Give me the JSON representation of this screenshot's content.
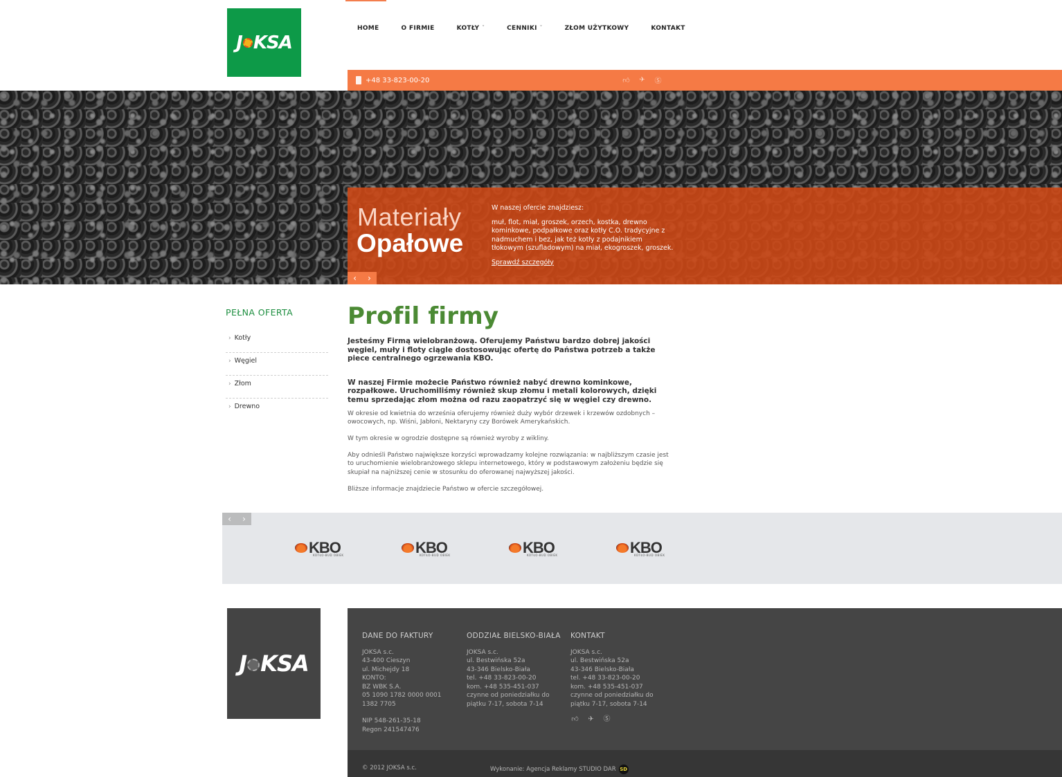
{
  "logo": {
    "left": "J",
    "right": "KSA"
  },
  "nav": {
    "items": [
      {
        "label": "HOME",
        "has_dropdown": false
      },
      {
        "label": "O FIRMIE",
        "has_dropdown": false
      },
      {
        "label": "KOTŁY",
        "has_dropdown": true
      },
      {
        "label": "CENNIKI",
        "has_dropdown": true
      },
      {
        "label": "ZŁOM UŻYTKOWY",
        "has_dropdown": false
      },
      {
        "label": "KONTAKT",
        "has_dropdown": false
      }
    ]
  },
  "topbar": {
    "phone": "+48 33-823-00-20"
  },
  "hero": {
    "title_light": "Materiały",
    "title_bold": "Opałowe",
    "lead": "W naszej ofercie znajdziesz:",
    "description": "muł, flot, miał, groszek, orzech, kostka, drewno kominkowe, podpałkowe oraz kotły C.O. tradycyjne z nadmuchem i bez, jak też kotły z podajnikiem tłokowym (szufladowym) na miał, ekogroszek, groszek.",
    "link": "Sprawdź szczegóły",
    "prev": "‹",
    "next": "›"
  },
  "sidebar": {
    "title": "PEŁNA OFERTA",
    "items": [
      "Kotły",
      "Węgiel",
      "Złom",
      "Drewno"
    ]
  },
  "main": {
    "title": "Profil firmy",
    "bold1": "Jesteśmy Firmą wielobranżową. Oferujemy Państwu bardzo dobrej jakości węgiel, muły i floty ciągle dostosowując ofertę do Państwa potrzeb a także piece centralnego ogrzewania KBO.",
    "bold2": "W naszej Firmie możecie Państwo również nabyć drewno kominkowe, rozpałkowe. Uruchomiliśmy również skup złomu i metali kolorowych, dzięki temu sprzedając złom można od razu zaopatrzyć się w węgiel czy drewno.",
    "p1": "W okresie od kwietnia do września oferujemy również duży wybór drzewek i krzewów ozdobnych – owocowych, np. Wiśni, Jabłoni, Nektaryny czy Borówek Amerykańskich.",
    "p2": "W tym okresie w ogrodzie dostępne są również wyroby z wikliny.",
    "p3": "Aby odnieśli Państwo największe korzyści wprowadzamy kolejne rozwiązania: w najbliższym czasie jest to uruchomienie wielobranżowego sklepu internetowego, który w podstawowym założeniu będzie się skupiał na najniższej cenie w stosunku do oferowanej najwyższej jakości.",
    "p4": "Bliższe informacje znajdziecie Państwo w ofercie szczegółowej."
  },
  "partners": {
    "prev": "‹",
    "next": "›",
    "logos": [
      {
        "word": "KBO",
        "sub": "KOTŁO-BUD OBIEK"
      },
      {
        "word": "KBO",
        "sub": "KOTŁO-BUD OBIEK"
      },
      {
        "word": "KBO",
        "sub": "KOTŁO-BUD OBIEK"
      },
      {
        "word": "KBO",
        "sub": "KOTŁO-BUD OBIEK"
      }
    ]
  },
  "footer": {
    "col1": {
      "title": "DANE DO FAKTURY",
      "lines": [
        "JOKSA s.c.",
        "43-400 Cieszyn",
        "ul. Michejdy 18",
        "KONTO:",
        "BZ WBK S.A.",
        "05 1090 1782 0000 0001",
        "1382 7705"
      ],
      "lines2": [
        "NIP 548-261-35-18",
        "Regon 241547476"
      ]
    },
    "col2": {
      "title": "ODDZIAŁ BIELSKO-BIAŁA",
      "lines": [
        "JOKSA s.c.",
        "ul. Bestwińska 52a",
        "43-346 Bielsko-Biała",
        "tel. +48 33-823-00-20",
        "kom. +48 535-451-037",
        "czynne od poniedziałku do",
        "piątku 7-17, sobota 7-14"
      ]
    },
    "col3": {
      "title": "KONTAKT",
      "lines": [
        "JOKSA s.c.",
        "ul. Bestwińska 52a",
        "43-346 Bielsko-Biała",
        "tel. +48 33-823-00-20",
        "kom. +48 535-451-037",
        "czynne od poniedziałku do",
        "piątku 7-17, sobota 7-14"
      ]
    },
    "copyright": "© 2012 JOKSA s.c.",
    "credits": "Wykonanie: Agencja Reklamy STUDIO DAR",
    "credits_badge": "SD"
  },
  "icons": {
    "social": [
      "thumbs-up-icon",
      "twitter-bird-icon",
      "skype-icon"
    ],
    "accent": "#f57a45",
    "brand_green": "#0d9a48"
  }
}
